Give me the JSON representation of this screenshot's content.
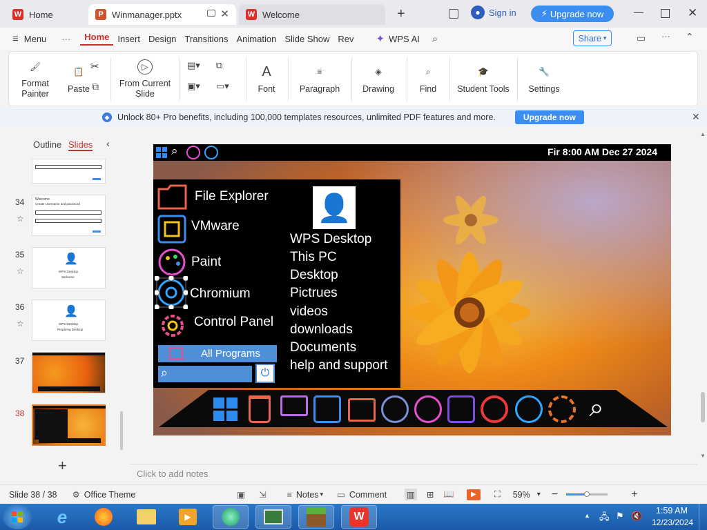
{
  "tabs": [
    {
      "label": "Home"
    },
    {
      "label": "Winmanager.pptx"
    },
    {
      "label": "Welcome"
    }
  ],
  "title_bar": {
    "sign_in": "Sign in",
    "upgrade": "Upgrade now"
  },
  "menubar": {
    "menu": "Menu",
    "items": [
      "Home",
      "Insert",
      "Design",
      "Transitions",
      "Animation",
      "Slide Show",
      "Rev"
    ],
    "wps_ai": "WPS AI",
    "share": "Share"
  },
  "ribbon": {
    "format_painter": "Format Painter",
    "paste": "Paste",
    "from_current_slide": "From Current Slide",
    "font": "Font",
    "paragraph": "Paragraph",
    "drawing": "Drawing",
    "find": "Find",
    "student_tools": "Student Tools",
    "settings": "Settings"
  },
  "banner": {
    "text": "Unlock 80+ Pro benefits, including 100,000 templates resources, unlimited PDF features and more.",
    "button": "Upgrade now"
  },
  "panel": {
    "outline": "Outline",
    "slides": "Slides"
  },
  "slides": [
    {
      "num": "34"
    },
    {
      "num": "35"
    },
    {
      "num": "36"
    },
    {
      "num": "37"
    },
    {
      "num": "38"
    }
  ],
  "thumb_text": {
    "s34_title": "Welcome",
    "s34_sub": "Create Username and password",
    "s35_title": "WPS Desktop",
    "s35_sub": "Welcome",
    "s36_title": "WPS Desktop",
    "s36_sub": "Preparing Desktop"
  },
  "slide_content": {
    "clock": "Fir 8:00 AM Dec 27 2024",
    "menu_items": [
      "File Explorer",
      "VMware",
      "Paint",
      "Chromium",
      "Control Panel"
    ],
    "all_programs": "All Programs",
    "right_links": [
      "WPS Desktop",
      "This PC",
      "Desktop",
      "Pictrues",
      "videos",
      "downloads",
      "Documents",
      "help and support"
    ]
  },
  "notes": {
    "placeholder": "Click to add notes"
  },
  "status": {
    "slide_count": "Slide 38 / 38",
    "theme": "Office Theme",
    "notes": "Notes",
    "comment": "Comment",
    "zoom": "59%"
  },
  "taskbar": {
    "time": "1:59 AM",
    "date": "12/23/2024"
  },
  "colors": {
    "accent_red": "#c8322d",
    "upgrade_blue": "#3b8df0",
    "taskbar_blue": "#1f66b8"
  }
}
